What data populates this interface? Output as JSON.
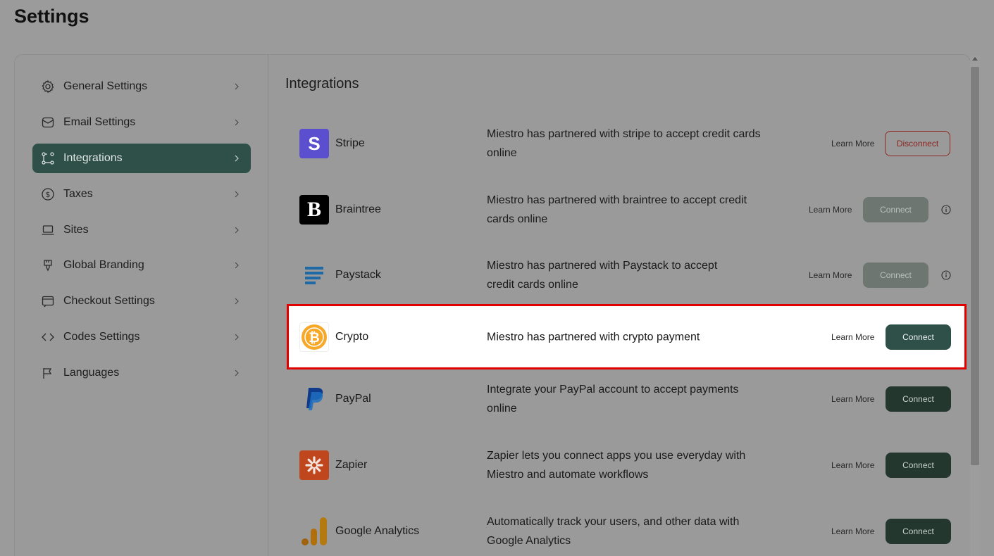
{
  "page": {
    "title": "Settings"
  },
  "sidebar": {
    "items": [
      {
        "label": "General Settings",
        "icon": "gear-icon"
      },
      {
        "label": "Email Settings",
        "icon": "mail-icon"
      },
      {
        "label": "Integrations",
        "icon": "integrations-icon",
        "active": true
      },
      {
        "label": "Taxes",
        "icon": "dollar-icon"
      },
      {
        "label": "Sites",
        "icon": "laptop-icon"
      },
      {
        "label": "Global Branding",
        "icon": "brush-icon"
      },
      {
        "label": "Checkout Settings",
        "icon": "checkout-icon"
      },
      {
        "label": "Codes Settings",
        "icon": "code-icon"
      },
      {
        "label": "Languages",
        "icon": "flag-icon"
      }
    ]
  },
  "main": {
    "title": "Integrations",
    "learn_more": "Learn More",
    "integrations": [
      {
        "name": "Stripe",
        "desc": "Miestro has partnered with stripe to accept credit cards online",
        "action": "Disconnect",
        "icon": "stripe-icon",
        "color": "#5b4fd0"
      },
      {
        "name": "Braintree",
        "desc": "Miestro has partnered with braintree to accept credit cards online",
        "action": "Connect",
        "icon": "braintree-icon",
        "info": true,
        "color": "#000000"
      },
      {
        "name": "Paystack",
        "desc": "Miestro has partnered with Paystack to accept credit cards online",
        "action": "Connect",
        "icon": "paystack-icon",
        "info": true,
        "color": "#1e6aa6"
      },
      {
        "name": "Crypto",
        "desc": "Miestro has partnered with crypto payment",
        "action": "Connect",
        "icon": "bitcoin-icon",
        "highlighted": true,
        "color": "#f7a829"
      },
      {
        "name": "PayPal",
        "desc": "Integrate your PayPal account to accept payments online",
        "action": "Connect",
        "icon": "paypal-icon",
        "color": "#0f3b8a"
      },
      {
        "name": "Zapier",
        "desc": "Zapier lets you connect apps you use everyday with Miestro and automate workflows",
        "action": "Connect",
        "icon": "zapier-icon",
        "color": "#c0461d"
      },
      {
        "name": "Google Analytics",
        "desc": "Automatically track your users, and other data with Google Analytics",
        "action": "Connect",
        "icon": "google-analytics-icon",
        "color": "#b06e0d"
      }
    ]
  }
}
